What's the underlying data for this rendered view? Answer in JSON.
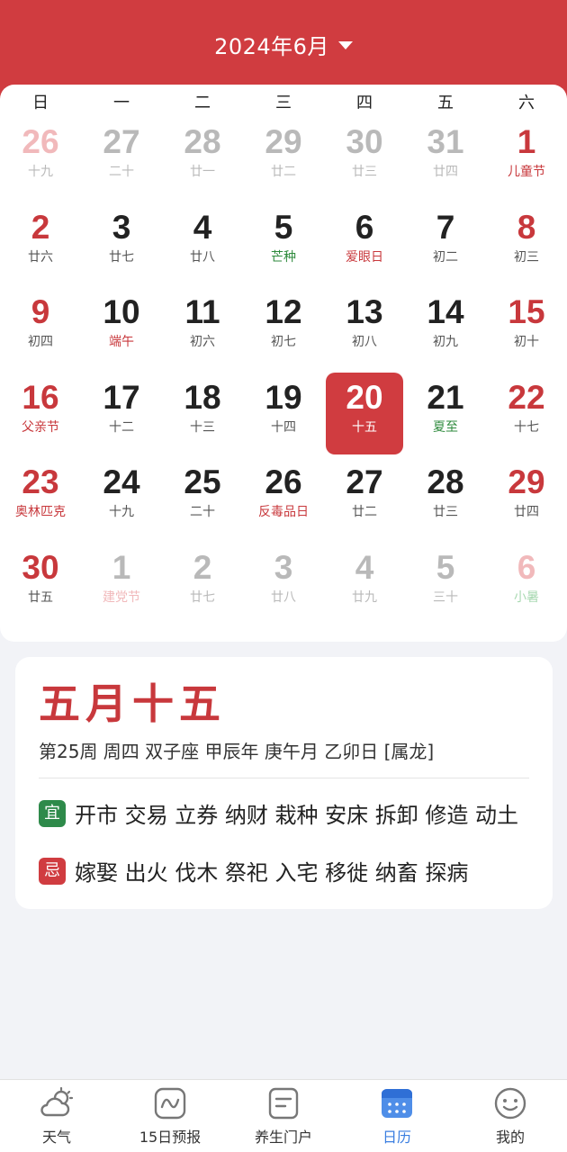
{
  "header": {
    "title": "2024年6月"
  },
  "weekdays": [
    "日",
    "一",
    "二",
    "三",
    "四",
    "五",
    "六"
  ],
  "calendar": {
    "weeks": [
      [
        {
          "d": "26",
          "l": "十九"
        },
        {
          "d": "27",
          "l": "二十"
        },
        {
          "d": "28",
          "l": "廿一"
        },
        {
          "d": "29",
          "l": "廿二"
        },
        {
          "d": "30",
          "l": "廿三"
        },
        {
          "d": "31",
          "l": "廿四"
        },
        {
          "d": "1",
          "l": "儿童节"
        }
      ],
      [
        {
          "d": "2",
          "l": "廿六"
        },
        {
          "d": "3",
          "l": "廿七"
        },
        {
          "d": "4",
          "l": "廿八"
        },
        {
          "d": "5",
          "l": "芒种"
        },
        {
          "d": "6",
          "l": "爱眼日"
        },
        {
          "d": "7",
          "l": "初二"
        },
        {
          "d": "8",
          "l": "初三"
        }
      ],
      [
        {
          "d": "9",
          "l": "初四"
        },
        {
          "d": "10",
          "l": "端午"
        },
        {
          "d": "11",
          "l": "初六"
        },
        {
          "d": "12",
          "l": "初七"
        },
        {
          "d": "13",
          "l": "初八"
        },
        {
          "d": "14",
          "l": "初九"
        },
        {
          "d": "15",
          "l": "初十"
        }
      ],
      [
        {
          "d": "16",
          "l": "父亲节"
        },
        {
          "d": "17",
          "l": "十二"
        },
        {
          "d": "18",
          "l": "十三"
        },
        {
          "d": "19",
          "l": "十四"
        },
        {
          "d": "20",
          "l": "十五"
        },
        {
          "d": "21",
          "l": "夏至"
        },
        {
          "d": "22",
          "l": "十七"
        }
      ],
      [
        {
          "d": "23",
          "l": "奥林匹克"
        },
        {
          "d": "24",
          "l": "十九"
        },
        {
          "d": "25",
          "l": "二十"
        },
        {
          "d": "26",
          "l": "反毒品日"
        },
        {
          "d": "27",
          "l": "廿二"
        },
        {
          "d": "28",
          "l": "廿三"
        },
        {
          "d": "29",
          "l": "廿四"
        }
      ],
      [
        {
          "d": "30",
          "l": "廿五"
        },
        {
          "d": "1",
          "l": "建党节"
        },
        {
          "d": "2",
          "l": "廿七"
        },
        {
          "d": "3",
          "l": "廿八"
        },
        {
          "d": "4",
          "l": "廿九"
        },
        {
          "d": "5",
          "l": "三十"
        },
        {
          "d": "6",
          "l": "小暑"
        }
      ]
    ]
  },
  "info": {
    "lunar_date": "五月十五",
    "detail": "第25周 周四  双子座  甲辰年  庚午月  乙卯日 [属龙]",
    "yi_label": "宜",
    "yi_text": "开市 交易 立券 纳财 栽种 安床 拆卸 修造 动土",
    "ji_label": "忌",
    "ji_text": "嫁娶 出火 伐木 祭祀 入宅 移徙 纳畜 探病"
  },
  "tabs": [
    {
      "label": "天气",
      "icon": "weather-icon"
    },
    {
      "label": "15日预报",
      "icon": "forecast-icon"
    },
    {
      "label": "养生门户",
      "icon": "notes-icon"
    },
    {
      "label": "日历",
      "icon": "calendar-icon"
    },
    {
      "label": "我的",
      "icon": "smile-icon"
    }
  ],
  "colors": {
    "primary_red": "#d03c40",
    "term_green": "#2e8a3c",
    "active_blue": "#3a7ee0"
  }
}
